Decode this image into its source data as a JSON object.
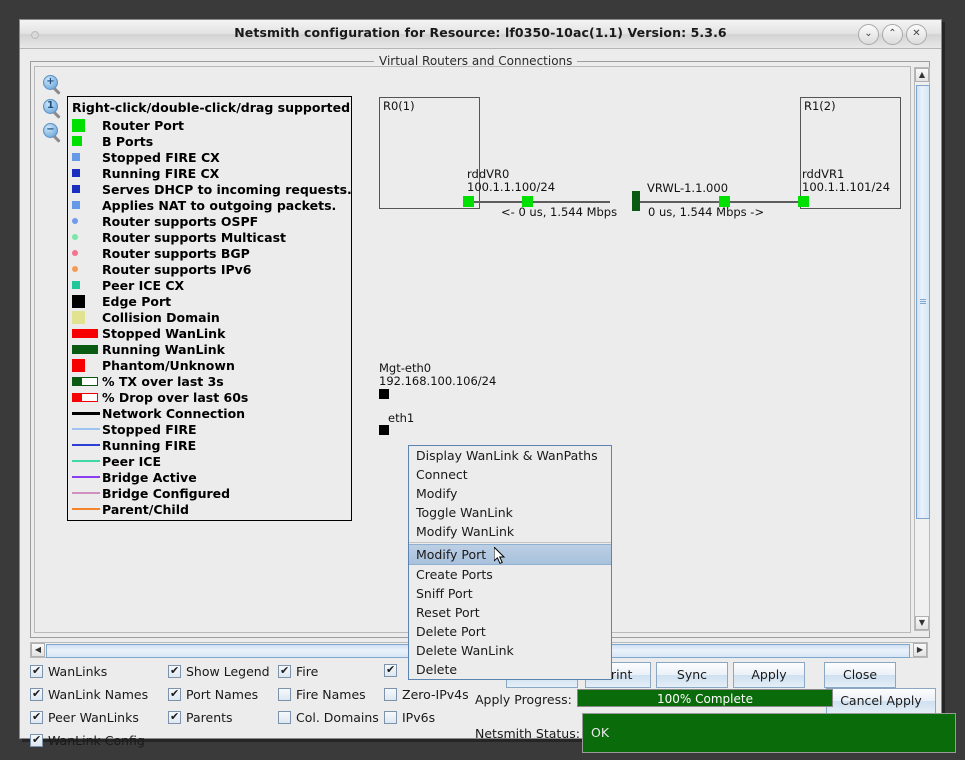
{
  "window": {
    "title": "Netsmith configuration for Resource:  lf0350-10ac(1.1)  Version: 5.3.6",
    "minimize_icon": "chevron-down-icon",
    "maximize_icon": "chevron-up-icon",
    "close_icon": "close-icon",
    "min_glyph": "⌄",
    "max_glyph": "⌃",
    "close_glyph": "✕"
  },
  "canvas": {
    "group_title": "Virtual Routers and Connections",
    "zoom_in_label": "+",
    "zoom_one_label": "1",
    "zoom_out_label": "−"
  },
  "legend": {
    "header": "Right-click/double-click/drag supported",
    "items": [
      {
        "label": "Router Port",
        "swatch": "square-large",
        "color": "#00e000"
      },
      {
        "label": "B Ports",
        "swatch": "square-medium",
        "color": "#00e000"
      },
      {
        "label": "Stopped FIRE CX",
        "swatch": "square-small",
        "color": "#6699e8"
      },
      {
        "label": "Running FIRE CX",
        "swatch": "square-small",
        "color": "#1a2fc0"
      },
      {
        "label": "Serves DHCP to incoming requests.",
        "swatch": "square-small",
        "color": "#1a2fc0"
      },
      {
        "label": "Applies NAT to outgoing packets.",
        "swatch": "square-small",
        "color": "#6699e8"
      },
      {
        "label": "Router supports OSPF",
        "swatch": "dot",
        "color": "#6f9af0"
      },
      {
        "label": "Router supports Multicast",
        "swatch": "dot",
        "color": "#76e8a8"
      },
      {
        "label": "Router supports BGP",
        "swatch": "dot",
        "color": "#f4738e"
      },
      {
        "label": "Router supports IPv6",
        "swatch": "dot",
        "color": "#f59b54"
      },
      {
        "label": "Peer ICE CX",
        "swatch": "square-small",
        "color": "#20c79a"
      },
      {
        "label": "Edge Port",
        "swatch": "square-large",
        "color": "#000000"
      },
      {
        "label": "Collision Domain",
        "swatch": "square-large",
        "color": "#e2e391"
      },
      {
        "label": "Stopped WanLink",
        "swatch": "bar",
        "color": "#f70000"
      },
      {
        "label": "Running WanLink",
        "swatch": "bar",
        "color": "#0a5a12"
      },
      {
        "label": "Phantom/Unknown",
        "swatch": "square-large",
        "color": "#f70000"
      },
      {
        "label": "% TX over last 3s",
        "swatch": "bar-partial",
        "color": "#0a5a12",
        "fill": 38
      },
      {
        "label": "% Drop over last 60s",
        "swatch": "bar-partial",
        "color": "#f70000",
        "fill": 38
      },
      {
        "label": "Network Connection",
        "swatch": "line-thick",
        "color": "#000000"
      },
      {
        "label": "Stopped FIRE",
        "swatch": "line",
        "color": "#9dc3f0"
      },
      {
        "label": "Running FIRE",
        "swatch": "line",
        "color": "#2b3fd8"
      },
      {
        "label": "Peer ICE",
        "swatch": "line",
        "color": "#3fd9a8"
      },
      {
        "label": "Bridge Active",
        "swatch": "line",
        "color": "#8c3ff0"
      },
      {
        "label": "Bridge Configured",
        "swatch": "line",
        "color": "#d091c0"
      },
      {
        "label": "Parent/Child",
        "swatch": "line",
        "color": "#f5842a"
      }
    ]
  },
  "diagram": {
    "router0_label": "R0(1)",
    "router1_label": "R1(2)",
    "port0_name": "rddVR0",
    "port0_ip": "100.1.1.100/24",
    "port1_name": "rddVR1",
    "port1_ip": "100.1.1.101/24",
    "wanlink_name": "VRWL-1.1.000",
    "rate_left": "<- 0 us, 1.544 Mbps",
    "rate_right": "0 us, 1.544 Mbps ->",
    "mgt_name": "Mgt-eth0",
    "mgt_ip": "192.168.100.106/24",
    "eth1_name": "eth1"
  },
  "context_menu": {
    "items": [
      {
        "label": "Display WanLink & WanPaths",
        "selected": false
      },
      {
        "label": "Connect",
        "selected": false
      },
      {
        "label": "Modify",
        "selected": false
      },
      {
        "label": "Toggle WanLink",
        "selected": false
      },
      {
        "label": "Modify WanLink",
        "selected": false
      },
      {
        "label": "Modify Port",
        "selected": true
      },
      {
        "label": "Create Ports",
        "selected": false
      },
      {
        "label": "Sniff Port",
        "selected": false
      },
      {
        "label": "Reset Port",
        "selected": false
      },
      {
        "label": "Delete Port",
        "selected": false
      },
      {
        "label": "Delete WanLink",
        "selected": false
      },
      {
        "label": "Delete",
        "selected": false
      }
    ]
  },
  "options": {
    "col1": [
      {
        "label": "WanLinks",
        "checked": true
      },
      {
        "label": "WanLink Names",
        "checked": true
      },
      {
        "label": "Peer WanLinks",
        "checked": true
      },
      {
        "label": "WanLink Config",
        "checked": true
      }
    ],
    "col2": [
      {
        "label": "Show Legend",
        "checked": true
      },
      {
        "label": "Port Names",
        "checked": true
      },
      {
        "label": "Parents",
        "checked": true
      }
    ],
    "col3": [
      {
        "label": "Fire",
        "checked": true
      },
      {
        "label": "Fire Names",
        "checked": false
      },
      {
        "label": "Col. Domains",
        "checked": false
      }
    ],
    "col4": [
      {
        "label": "",
        "checked": true
      },
      {
        "label": "Zero-IPv4s",
        "checked": false
      },
      {
        "label": "IPv6s",
        "checked": false
      }
    ]
  },
  "buttons": {
    "hidden": "...",
    "print": "Print",
    "sync": "Sync",
    "apply": "Apply",
    "close": "Close",
    "cancel_apply": "Cancel Apply"
  },
  "status": {
    "progress_label": "Apply Progress:",
    "progress_text": "100% Complete",
    "progress_percent": 100,
    "netsmith_label": "Netsmith Status:",
    "netsmith_value": "OK"
  },
  "scroll": {
    "up_glyph": "▲",
    "down_glyph": "▼",
    "left_glyph": "◀",
    "right_glyph": "▶"
  }
}
